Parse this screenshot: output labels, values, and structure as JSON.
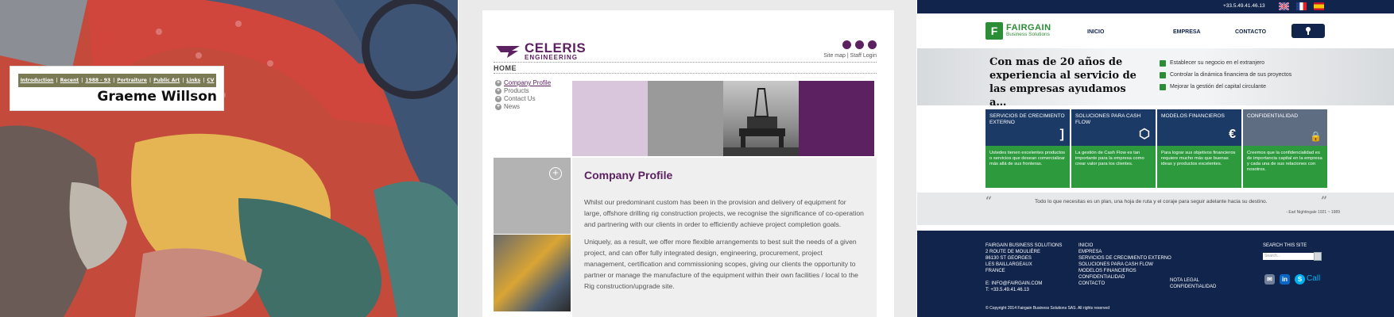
{
  "panel1": {
    "nav": [
      "Introduction",
      "Recent",
      "1988 - 93",
      "Portraiture",
      "Public Art",
      "Links",
      "CV"
    ],
    "name": "Graeme Willson"
  },
  "panel2": {
    "logo_main": "CELERIS",
    "logo_sub": "ENGINEERING",
    "toplinks": {
      "sitemap": "Site map",
      "sep": "|",
      "login": "Staff Login"
    },
    "home": "HOME",
    "menu": [
      "Company Profile",
      "Products",
      "Contact Us",
      "News"
    ],
    "heading": "Company Profile",
    "para1": "Whilst our predominant custom has been in the provision and delivery of equipment for large, offshore drilling rig construction projects, we recognise the significance of co-operation and partnering with our clients in order to efficiently achieve project completion goals.",
    "para2": "Uniquely, as a result, we offer more flexible arrangements to best suit the needs of a given project, and can offer fully integrated design, engineering, procurement, project management, certification and commissioning scopes, giving our clients the opportunity to partner or manage the manufacture of the equipment within their own facilities / local to the Rig construction/upgrade site.",
    "colors": {
      "purple": "#5c2161",
      "lilac": "#dac6dc",
      "gray": "#9a9a9a"
    }
  },
  "panel3": {
    "phone": "+33.5.49.41.46.13",
    "logo_main": "FAIRGAIN",
    "logo_sub": "Business Solutions",
    "nav": [
      "INICIO",
      "EMPRESA",
      "CONTACTO"
    ],
    "hero_title": "Con mas de 20 años de experiencia al servicio de las empresas ayudamos a…",
    "bullets": [
      "Establecer su negocio en el extranjero",
      "Controlar la dinámica financiera de sus proyectos",
      "Mejorar la gestión del capital circulante"
    ],
    "cards": [
      {
        "title": "SERVICIOS DE CRECIMIENTO EXTERNO",
        "icon": "]",
        "text": "Ustedes tienen excelentes productos o servicios que desean comercializar más allá de sus fronteras."
      },
      {
        "title": "SOLUCIONES PARA CASH FLOW",
        "icon": "⬡",
        "text": "La gestión de Cash Flow es tan importante para la empresa como crear valor para los clientes."
      },
      {
        "title": "MODELOS FINANCIEROS",
        "icon": "€",
        "text": "Para lograr sus objetivos financieros requiere mucho más que buenas ideas y productos excelentes."
      },
      {
        "title": "CONFIDENTIALIDAD",
        "icon": "🔒",
        "text": "Creemos que la confidencialidad es de importancia capital en la empresa y cada una de sus relaciones con nosotros."
      }
    ],
    "quote": "Todo lo que necesitas es un plan, una hoja de ruta y el coraje para seguir adelante hacia su destino.",
    "quote_author": "- Earl Nightingale 1921 ~ 1989",
    "footer_address": [
      "FAIRGAIN BUSINESS SOLUTIONS",
      "2 ROUTE DE MOULIÈRE",
      "86130 ST GEORGES",
      "LES BAILLARGEAUX",
      "FRANCE",
      "",
      "E: INFO@FAIRGAIN.COM",
      "T: +33.5.49.41.46.13"
    ],
    "footer_links": [
      "INICIO",
      "EMPRESA",
      "SERVICIOS DE CRECIMIENTO EXTERNO",
      "SOLUCIONES PARA CASH FLOW",
      "MODELOS FINANCIEROS",
      "CONFIDENTIALIDAD",
      "CONTACTO"
    ],
    "footer_legal": [
      "NOTA LEGAL",
      "CONFIDENTIALIDAD"
    ],
    "search_label": "SEARCH THIS SITE",
    "search_placeholder": "Search...",
    "social_call": "Call",
    "copyright": "© Copyright 2014 Fairgain Business Solutions SAS. All rights reserved",
    "colors": {
      "navy": "#11244b",
      "green": "#2c9a3d",
      "card_top": "#1c3a66"
    }
  }
}
